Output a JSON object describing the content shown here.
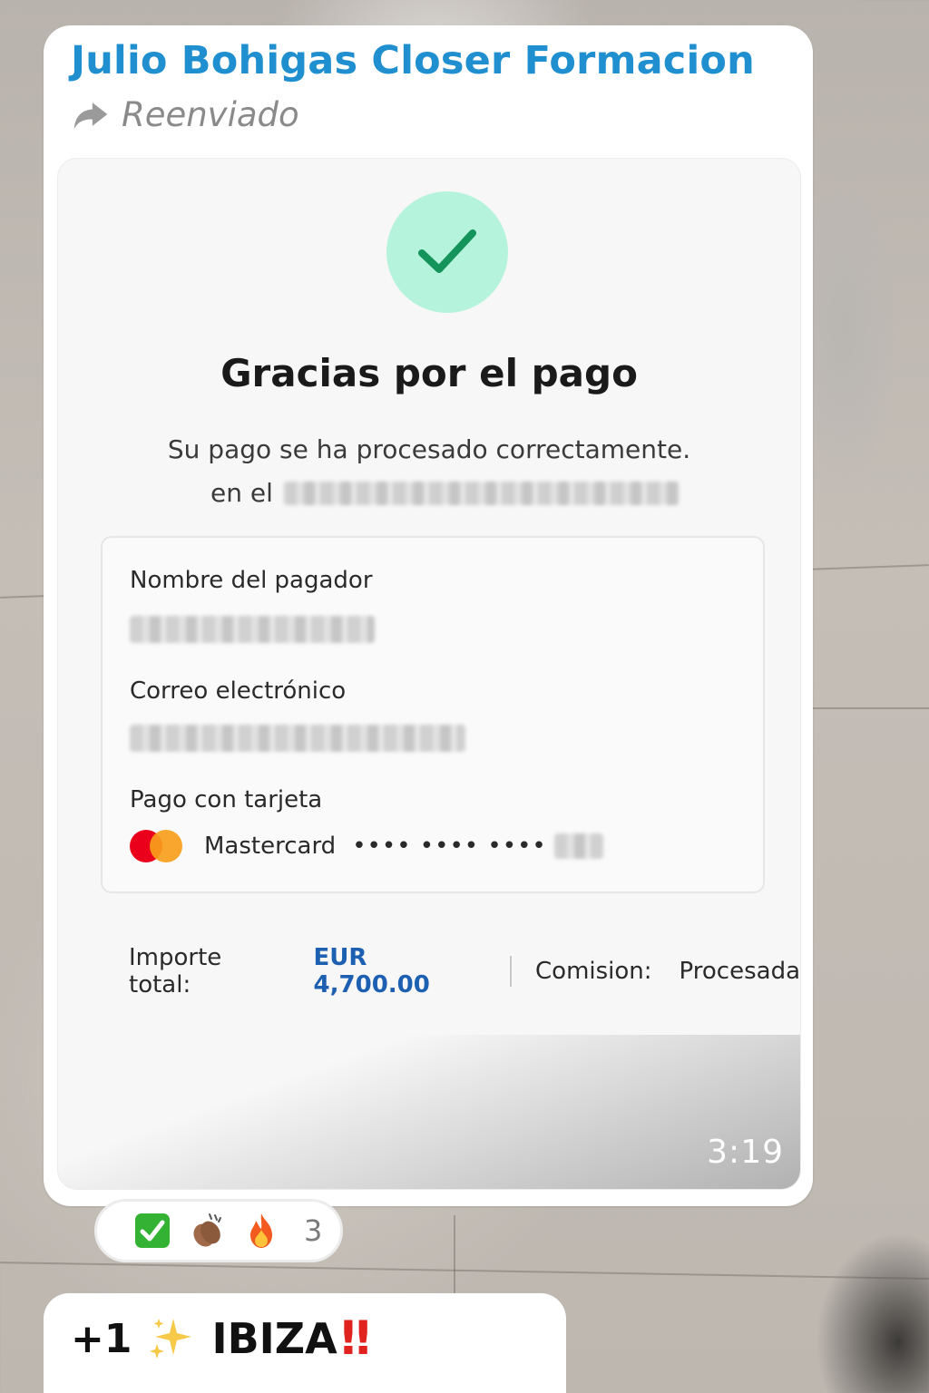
{
  "message": {
    "sender": "Julio Bohigas Closer Formacion",
    "forwarded_label": "Reenviado",
    "time": "3:19",
    "receipt": {
      "title": "Gracias por el pago",
      "subtitle": "Su pago se ha procesado correctamente.",
      "merchant_prefix": "en el",
      "payer_name_label": "Nombre del pagador",
      "email_label": "Correo electrónico",
      "card_label": "Pago con tarjeta",
      "card_brand": "Mastercard",
      "card_mask": "•••• •••• ••••",
      "total_label": "Importe total:",
      "total_amount": "EUR 4,700.00",
      "fee_label": "Comision:",
      "fee_value": "Procesada"
    }
  },
  "reactions": {
    "items": [
      "check-mark-button-icon",
      "clapping-hands-icon",
      "fire-icon"
    ],
    "count": "3"
  },
  "next_message": {
    "prefix": "+1",
    "word": "IBIZA",
    "emphasis": "‼"
  },
  "colors": {
    "sender": "#1f8fd0",
    "check_bg": "#b6f3dc",
    "check_stroke": "#14935a",
    "amount": "#1d5fb0"
  }
}
